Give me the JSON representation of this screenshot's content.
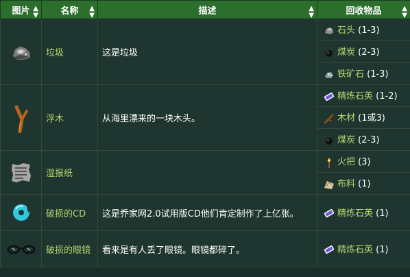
{
  "headers": {
    "image": "图片",
    "name": "名称",
    "description": "描述",
    "recycle": "回收物品"
  },
  "rows": [
    {
      "name": "垃圾",
      "description": "这是垃圾",
      "icon": "trash-icon",
      "items": [
        {
          "icon": "stone-icon",
          "name": "石头",
          "qty": " (1-3)"
        },
        {
          "icon": "coal-icon",
          "name": "煤炭",
          "qty": " (2-3)"
        },
        {
          "icon": "iron-ore-icon",
          "name": "铁矿石",
          "qty": " (1-3)"
        }
      ]
    },
    {
      "name": "浮木",
      "description": "从海里漂来的一块木头。",
      "icon": "driftwood-icon",
      "items": [
        {
          "icon": "refined-quartz-icon",
          "name": "精炼石英",
          "qty": " (1-2)"
        },
        {
          "icon": "wood-icon",
          "name": "木材",
          "qty": " (1或3)"
        },
        {
          "icon": "coal-icon",
          "name": "煤炭",
          "qty": " (2-3)"
        }
      ]
    },
    {
      "name": "湿报纸",
      "description": "",
      "icon": "soggy-newspaper-icon",
      "items": [
        {
          "icon": "torch-icon",
          "name": "火把",
          "qty": " (3)"
        },
        {
          "icon": "cloth-icon",
          "name": "布料",
          "qty": " (1)"
        }
      ]
    },
    {
      "name": "破损的CD",
      "description": "这是乔家网2.0试用版CD他们肯定制作了上亿张。",
      "icon": "broken-cd-icon",
      "items": [
        {
          "icon": "refined-quartz-icon",
          "name": "精炼石英",
          "qty": " (1)"
        }
      ]
    },
    {
      "name": "破损的眼镜",
      "description": "看来是有人丢了眼镜。眼镜都碎了。",
      "icon": "broken-glasses-icon",
      "items": [
        {
          "icon": "refined-quartz-icon",
          "name": "精炼石英",
          "qty": " (1)"
        }
      ]
    }
  ]
}
